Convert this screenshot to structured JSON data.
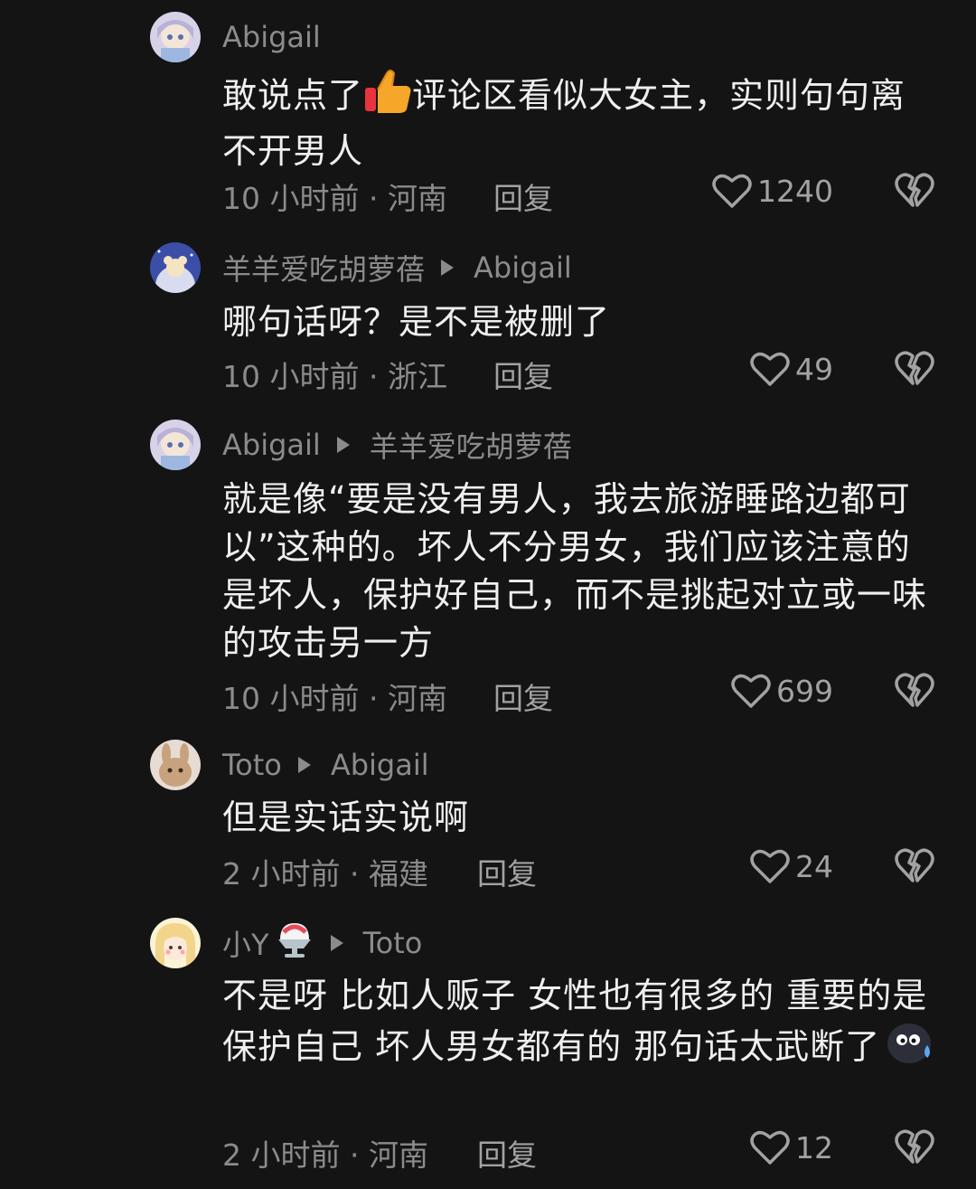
{
  "comments": [
    {
      "user": "Abigail",
      "reply_to": "",
      "text": "敢说点了👍评论区看似大女主，实则句句离不开男人",
      "text_before_emoji": "敢说点了",
      "emoji": "thumbs-up-emoji",
      "text_after_emoji": "评论区看似大女主，实则句句离不开男人",
      "time_location": "10 小时前 · 河南",
      "reply_label": "回复",
      "likes": "1240"
    },
    {
      "user": "羊羊爱吃胡萝蓓",
      "reply_to": "Abigail",
      "text": "哪句话呀？是不是被删了",
      "time_location": "10 小时前 · 浙江",
      "reply_label": "回复",
      "likes": "49"
    },
    {
      "user": "Abigail",
      "reply_to": "羊羊爱吃胡萝蓓",
      "text": "就是像“要是没有男人，我去旅游睡路边都可以”这种的。坏人不分男女，我们应该注意的是坏人，保护好自己，而不是挑起对立或一味的攻击另一方",
      "time_location": "10 小时前 · 河南",
      "reply_label": "回复",
      "likes": "699"
    },
    {
      "user": "Toto",
      "reply_to": "Abigail",
      "text": "但是实话实说啊",
      "time_location": "2 小时前 · 福建",
      "reply_label": "回复",
      "likes": "24"
    },
    {
      "user": "小Y",
      "user_emoji": "shaved-ice-emoji",
      "reply_to": "Toto",
      "text": "不是呀 比如人贩子 女性也有很多的 重要的是保护自己 坏人男女都有的 那句话太武断了",
      "text_end_emoji": "sweat-face-emoji",
      "time_location": "2 小时前 · 河南",
      "reply_label": "回复",
      "likes": "12"
    }
  ],
  "colors": {
    "background": "#141414",
    "text": "#efefef",
    "secondary": "#8b8b8b"
  }
}
